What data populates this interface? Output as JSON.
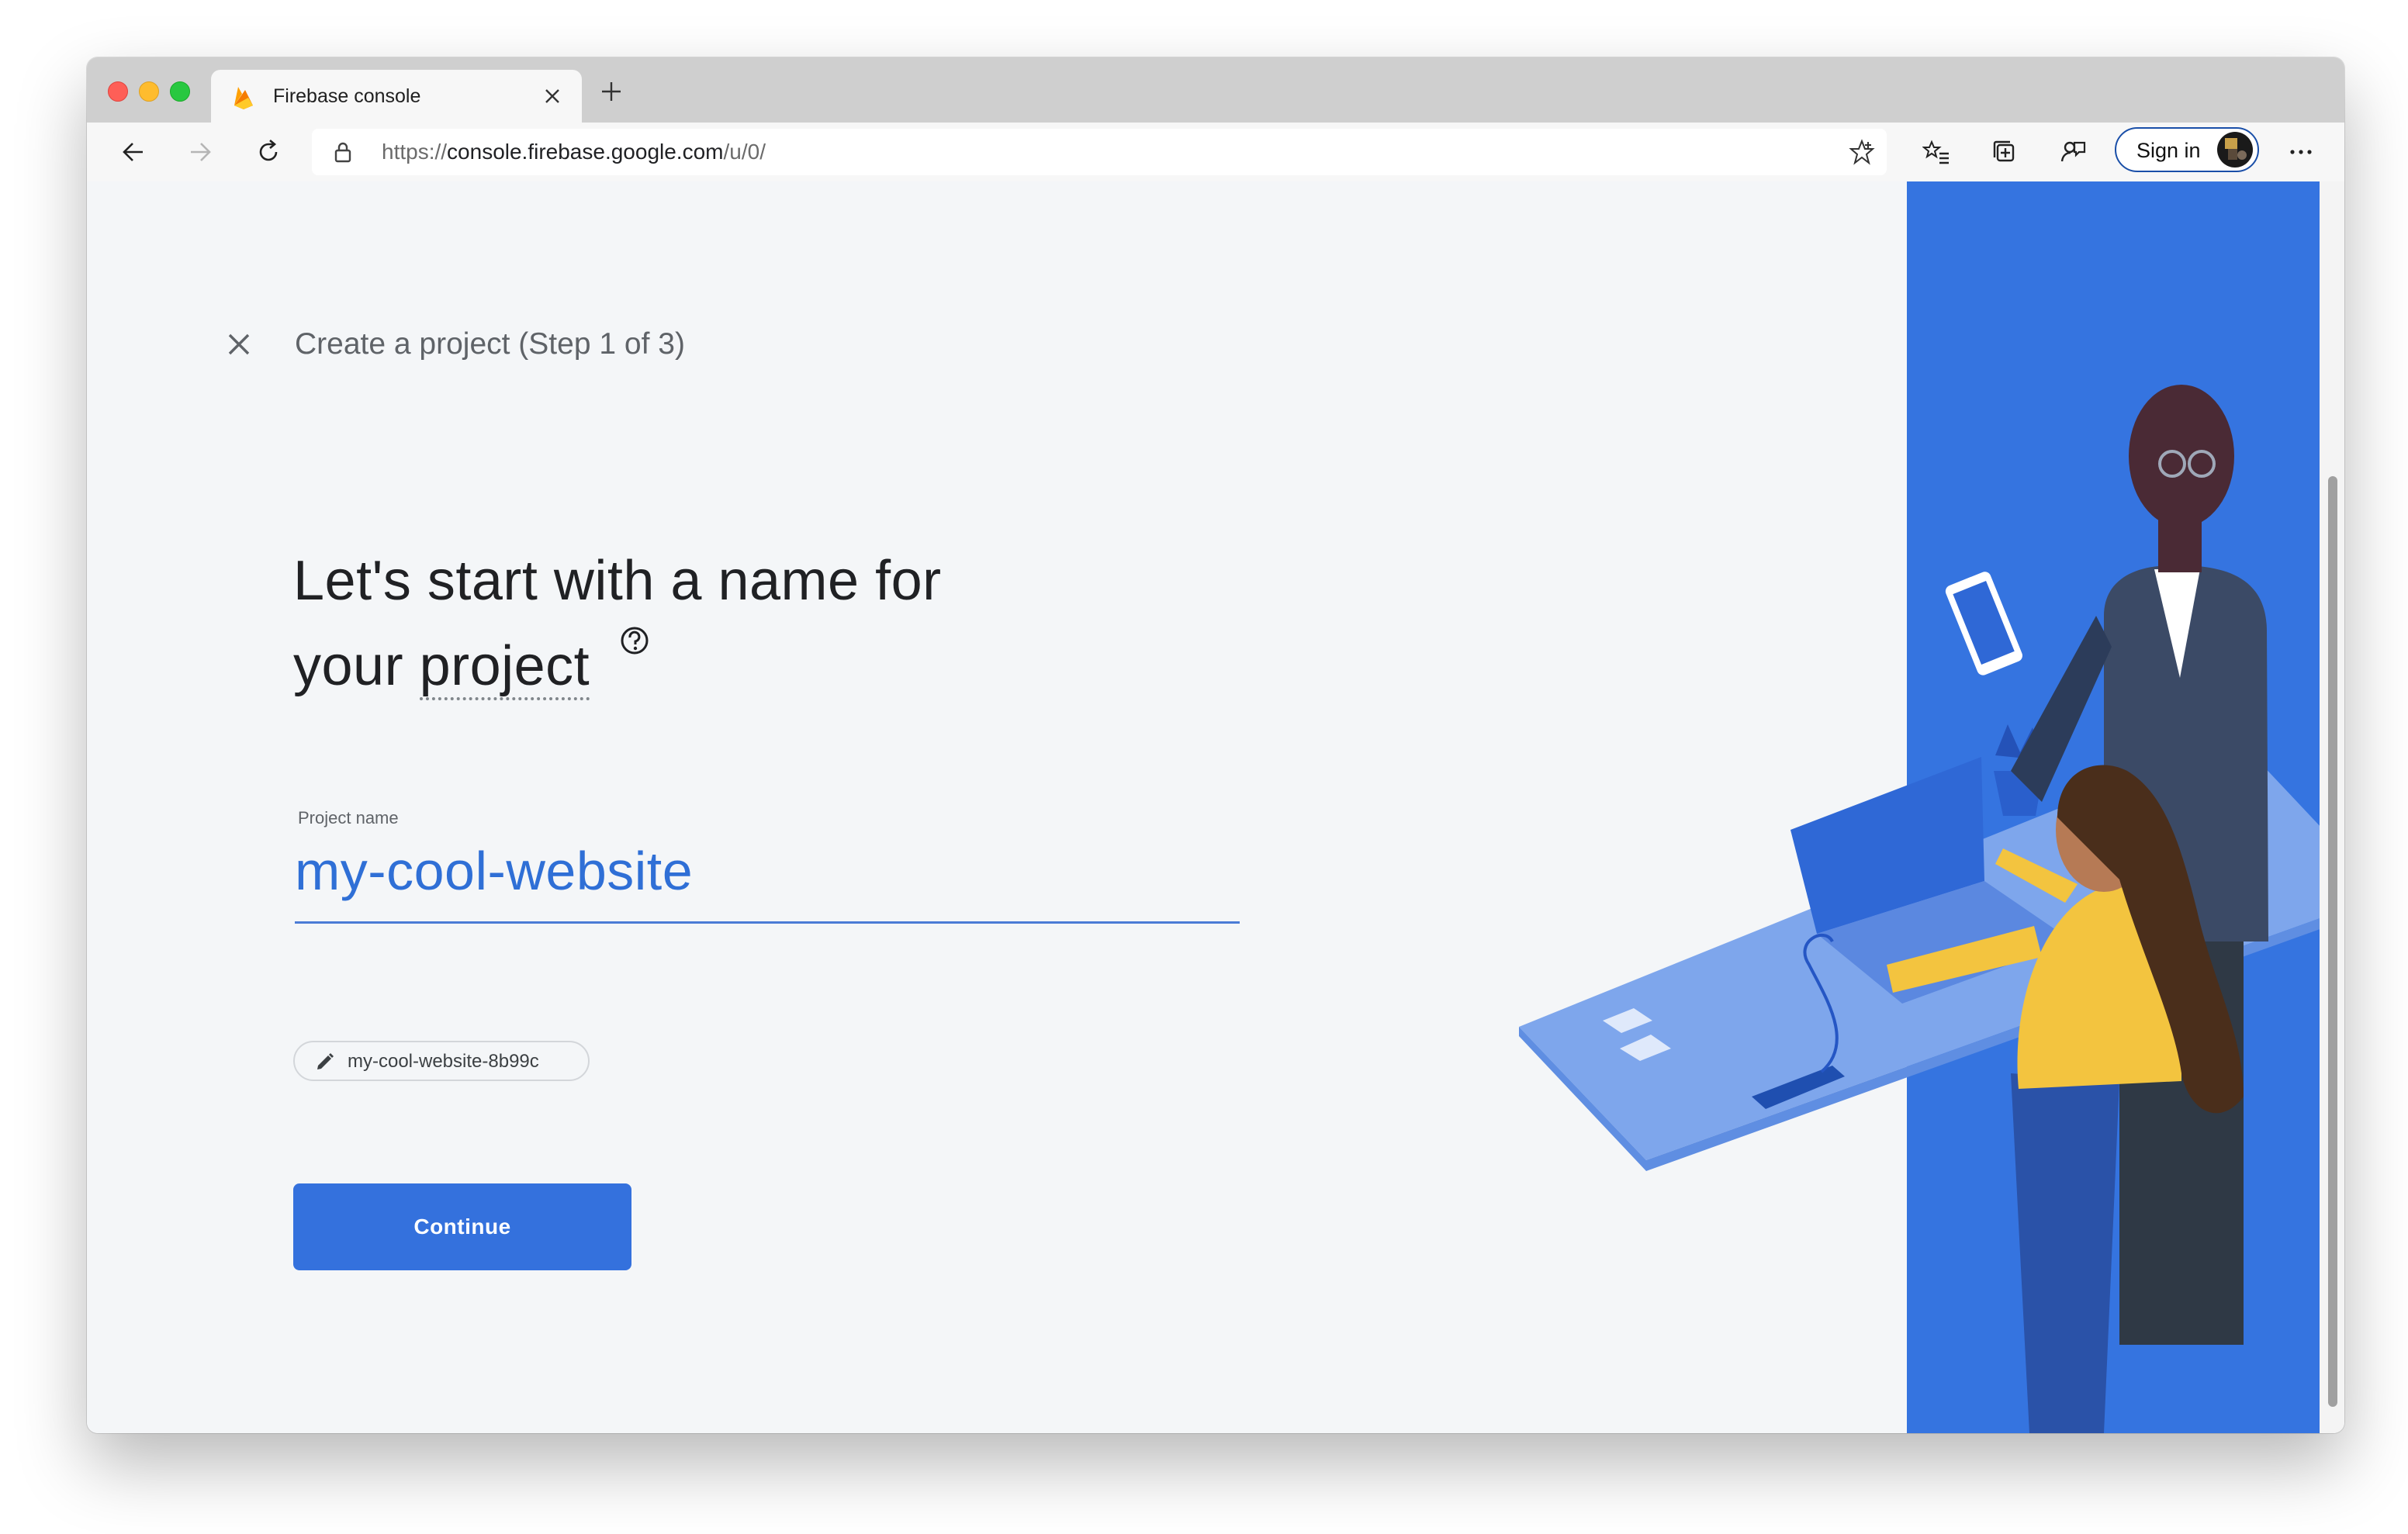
{
  "browser": {
    "tab_title": "Firebase console",
    "url_scheme": "https://",
    "url_host": "console.firebase.google.com",
    "url_path": "/u/0/",
    "sign_in_label": "Sign in",
    "icons": [
      "back-icon",
      "forward-icon",
      "refresh-icon",
      "lock-icon",
      "favorite-star-icon",
      "favorites-icon",
      "collections-icon",
      "feedback-icon",
      "more-icon"
    ]
  },
  "wizard": {
    "step_title": "Create a project (Step 1 of 3)",
    "headline_line1": "Let's start with a name for",
    "headline_line2_prefix": "your ",
    "headline_term": "project",
    "field_label": "Project name",
    "project_name_value": "my-cool-website",
    "project_id_chip": "my-cool-website-8b99c",
    "continue_label": "Continue"
  },
  "colors": {
    "accent": "#3471dd",
    "illustration_blue": "#3574e0",
    "headline": "#202124",
    "input_text": "#2f6fd6"
  }
}
